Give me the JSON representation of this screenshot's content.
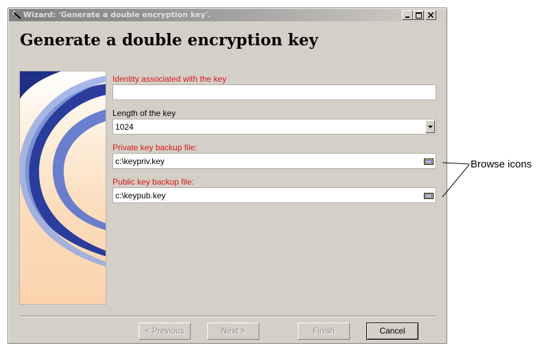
{
  "window": {
    "title": "Wizard: 'Generate a double encryption key'."
  },
  "page": {
    "heading": "Generate a double encryption key"
  },
  "form": {
    "identity": {
      "label": "Identity associated with the key",
      "value": ""
    },
    "length": {
      "label": "Length of the key",
      "value": "1024"
    },
    "private_backup": {
      "label": "Private key backup file:",
      "value": "c:\\keypriv.key"
    },
    "public_backup": {
      "label": "Public key backup file:",
      "value": "c:\\keypub.key"
    }
  },
  "buttons": {
    "previous": "< Previous",
    "next": "Next >",
    "finish": "Finish",
    "cancel": "Cancel"
  },
  "annotation": {
    "text": "Browse icons"
  },
  "colors": {
    "required_label": "#d81818",
    "dialog_face": "#d4d0c8",
    "art_swoosh_blue": "#2a3c9c",
    "art_swoosh_light": "#8fa6e4"
  },
  "icons": {
    "window": "wizard-wand-icon",
    "minimize": "minimize-icon",
    "maximize": "maximize-icon",
    "close": "close-icon",
    "dropdown": "chevron-down-icon",
    "browse": "folder-browse-icon"
  }
}
